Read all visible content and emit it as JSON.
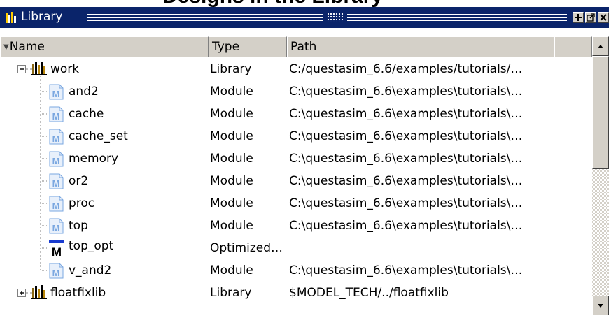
{
  "window": {
    "title": "Library",
    "cut_heading": "Designs in the Library"
  },
  "columns": [
    "Name",
    "Type",
    "Path"
  ],
  "rows": [
    {
      "name": "work",
      "type": "Library",
      "path": "C:/questasim_6.6/examples/tutorials/…",
      "icon": "library-icon",
      "expander": "minus"
    },
    {
      "name": "and2",
      "type": "Module",
      "path": "C:\\questasim_6.6\\examples\\tutorials\\…",
      "icon": "module-icon"
    },
    {
      "name": "cache",
      "type": "Module",
      "path": "C:\\questasim_6.6\\examples\\tutorials\\…",
      "icon": "module-icon"
    },
    {
      "name": "cache_set",
      "type": "Module",
      "path": "C:\\questasim_6.6\\examples\\tutorials\\…",
      "icon": "module-icon"
    },
    {
      "name": "memory",
      "type": "Module",
      "path": "C:\\questasim_6.6\\examples\\tutorials\\…",
      "icon": "module-icon"
    },
    {
      "name": "or2",
      "type": "Module",
      "path": "C:\\questasim_6.6\\examples\\tutorials\\…",
      "icon": "module-icon"
    },
    {
      "name": "proc",
      "type": "Module",
      "path": "C:\\questasim_6.6\\examples\\tutorials\\…",
      "icon": "module-icon"
    },
    {
      "name": "top",
      "type": "Module",
      "path": "C:\\questasim_6.6\\examples\\tutorials\\…",
      "icon": "module-icon"
    },
    {
      "name": "top_opt",
      "type": "Optimized…",
      "path": "",
      "icon": "optimized-module-icon"
    },
    {
      "name": "v_and2",
      "type": "Module",
      "path": "C:\\questasim_6.6\\examples\\tutorials\\…",
      "icon": "module-icon"
    },
    {
      "name": "floatfixlib",
      "type": "Library",
      "path": "$MODEL_TECH/../floatfixlib",
      "icon": "library-icon",
      "expander": "plus"
    }
  ],
  "colors": {
    "titlebar": "#0a246a",
    "chrome": "#d4d0c8",
    "module_icon": "#7aa7e0",
    "library_icon": "#b8860b"
  }
}
